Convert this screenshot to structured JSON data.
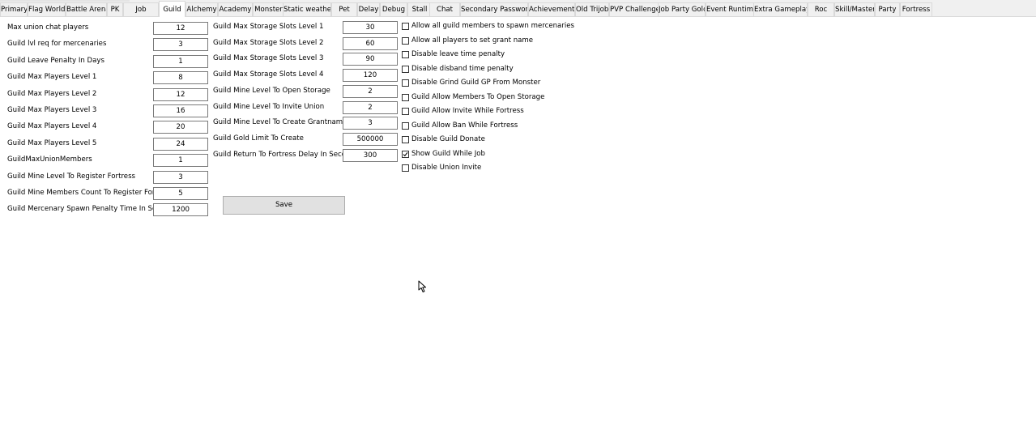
{
  "tabs": [
    {
      "label": "Primary",
      "active": false
    },
    {
      "label": "Flag World",
      "active": false
    },
    {
      "label": "Battle Arena",
      "active": false
    },
    {
      "label": "PK",
      "active": false
    },
    {
      "label": "Job",
      "active": false
    },
    {
      "label": "Guild",
      "active": true
    },
    {
      "label": "Alchemy",
      "active": false
    },
    {
      "label": "Academy",
      "active": false
    },
    {
      "label": "Monster",
      "active": false
    },
    {
      "label": "Static weather",
      "active": false
    },
    {
      "label": "Pet",
      "active": false
    },
    {
      "label": "Delay",
      "active": false
    },
    {
      "label": "Debug",
      "active": false
    },
    {
      "label": "Stall",
      "active": false
    },
    {
      "label": "Chat",
      "active": false
    },
    {
      "label": "Secondary Password",
      "active": false
    },
    {
      "label": "Achievements",
      "active": false
    },
    {
      "label": "Old Trijob",
      "active": false
    },
    {
      "label": "PVP Challenge",
      "active": false
    },
    {
      "label": "Job Party Gold",
      "active": false
    },
    {
      "label": "Event Runtime",
      "active": false
    },
    {
      "label": "Extra Gameplay",
      "active": false
    },
    {
      "label": "Roc",
      "active": false
    },
    {
      "label": "Skill/Mastery",
      "active": false
    },
    {
      "label": "Party",
      "active": false
    },
    {
      "label": "Fortress",
      "active": false
    }
  ],
  "left_fields": [
    {
      "label": "Max union chat players",
      "value": "12"
    },
    {
      "label": "Guild lvl req for mercenaries",
      "value": "3"
    },
    {
      "label": "Guild Leave Penalty In Days",
      "value": "1"
    },
    {
      "label": "Guild Max Players Level 1",
      "value": "8"
    },
    {
      "label": "Guild Max Players Level 2",
      "value": "12"
    },
    {
      "label": "Guild Max Players Level 3",
      "value": "16"
    },
    {
      "label": "Guild Max Players Level 4",
      "value": "20"
    },
    {
      "label": "Guild Max Players Level 5",
      "value": "24"
    },
    {
      "label": "GuildMaxUnionMembers",
      "value": "1"
    },
    {
      "label": "Guild Mine Level To Register Fortress",
      "value": "3"
    },
    {
      "label": "Guild Mine Members Count To Register Fortress",
      "value": "5"
    },
    {
      "label": "Guild Mercenary Spawn Penalty Time In Seconds",
      "value": "1200"
    }
  ],
  "middle_fields": [
    {
      "label": "Guild Max Storage Slots Level 1",
      "value": "30"
    },
    {
      "label": "Guild Max Storage Slots Level 2",
      "value": "60"
    },
    {
      "label": "Guild Max Storage Slots Level 3",
      "value": "90"
    },
    {
      "label": "Guild Max Storage Slots Level 4",
      "value": "120"
    },
    {
      "label": "Guild Mine Level To Open Storage",
      "value": "2"
    },
    {
      "label": "Guild Mine Level To Invite Union",
      "value": "2"
    },
    {
      "label": "Guild Mine Level To Create Grantname",
      "value": "3"
    },
    {
      "label": "Guild Gold Limit To Create",
      "value": "500000"
    },
    {
      "label": "Guild Return To Fortress Delay In Seconds",
      "value": "300"
    }
  ],
  "checkboxes": [
    {
      "label": "Allow all guild members to spawn mercenaries",
      "checked": false
    },
    {
      "label": "Allow all players to set grant name",
      "checked": false
    },
    {
      "label": "Disable leave time penalty",
      "checked": false
    },
    {
      "label": "Disable disband time penalty",
      "checked": false
    },
    {
      "label": "Disable Grind Guild GP From Monster",
      "checked": false
    },
    {
      "label": "Guild Allow Members To Open Storage",
      "checked": false
    },
    {
      "label": "Guild Allow Invite While Fortress",
      "checked": false
    },
    {
      "label": "Guild Allow Ban While Fortress",
      "checked": false
    },
    {
      "label": "Disable Guild Donate",
      "checked": false
    },
    {
      "label": "Show Guild While Job",
      "checked": true
    },
    {
      "label": "Disable Union Invite",
      "checked": false
    }
  ],
  "save_label": "Save"
}
